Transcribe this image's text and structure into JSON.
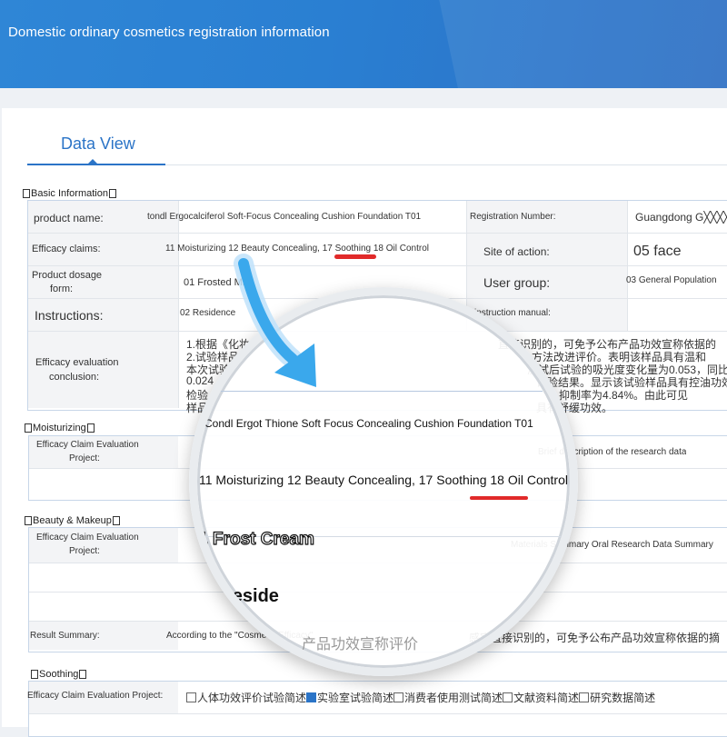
{
  "banner": {
    "title": "Domestic ordinary cosmetics registration information"
  },
  "tabs": {
    "data_view": "Data View"
  },
  "basic": {
    "heading": "Basic Information",
    "product_name_label": "product name:",
    "product_name_value": "tondl Ergocalciferol Soft-Focus Concealing Cushion Foundation T01",
    "registration_number_label": "Registration Number:",
    "registration_number_value": "Guangdong G╳╳╳╳202",
    "efficacy_claims_label": "Efficacy claims:",
    "efficacy_claims_value": "11 Moisturizing 12 Beauty Concealing, 17 Soothing 18 Oil Control",
    "site_of_action_label": "Site of action:",
    "site_of_action_value": "05 face",
    "dosage_form_label_1": "Product dosage",
    "dosage_form_label_2": "form:",
    "dosage_form_value": "01 Frosted Milk",
    "user_group_label": "User group:",
    "user_group_value": "03 General Population",
    "instructions_label": "Instructions:",
    "instructions_value": "02 Residence",
    "instruction_manual_label": "instruction manual:",
    "conclusion_label_1": "Efficacy evaluation",
    "conclusion_label_2": "conclusion:",
    "conclusion_line1": "1.根据《化妆",
    "conclusion_line1_right": "直接识别的，可免予公布产品功效宣称依据的",
    "conclusion_line2": "2.试验样品",
    "conclusion_line2_right": "方法改进评价。表明该样品具有温和",
    "conclusion_line3": "本次试验",
    "conclusion_line3_right": "测试后试验的吸光度变化量为0.053，同比",
    "conclusion_line4": "0.024",
    "conclusion_line4_right": "试验结果。显示该试验样品具有控油功效",
    "conclusion_line5": "检验",
    "conclusion_line5_right": "抑制率为4.84%。由此可见",
    "conclusion_line6": "样品",
    "conclusion_line6_right": "具有舒缓功效。"
  },
  "moisturizing": {
    "heading": "Moisturizing",
    "project_label_1": "Efficacy Claim Evaluation",
    "project_label_2": "Project:",
    "right_text": "Brief description of the research data"
  },
  "beauty": {
    "heading": "Beauty & Makeup",
    "project_label_1": "Efficacy Claim Evaluation",
    "project_label_2": "Project:",
    "right_text": "Materials Summary Oral Research Data Summary",
    "result_label": "Result Summary:",
    "result_value": "According to the \"Cosmetic Efficacy\"",
    "result_value_right": "感官直接识别的，可免予公布产品功效宣称依据的摘"
  },
  "soothing": {
    "heading": "Soothing",
    "project_label": "Efficacy Claim Evaluation Project:",
    "options": [
      {
        "label": "人体功效评价试验简述",
        "checked": false
      },
      {
        "label": "实验室试验简述",
        "checked": true
      },
      {
        "label": "消费者使用测试简述",
        "checked": false
      },
      {
        "label": "文献资料简述",
        "checked": false
      },
      {
        "label": "研究数据简述",
        "checked": false
      }
    ]
  },
  "magnifier": {
    "product_name": "Condl Ergot Thione Soft Focus Concealing Cushion Foundation T01",
    "efficacy": "11 Moisturizing 12 Beauty Concealing, 17 Soothing 18 Oil Control",
    "dosage": "001 Frost Cream",
    "instructions": "reside",
    "bottom_text": "产品功效宣称评价"
  },
  "colors": {
    "banner": "#2f86d6",
    "accent": "#2b74c7",
    "highlight": "#e12a2a",
    "arrow": "#3aa8ec"
  }
}
